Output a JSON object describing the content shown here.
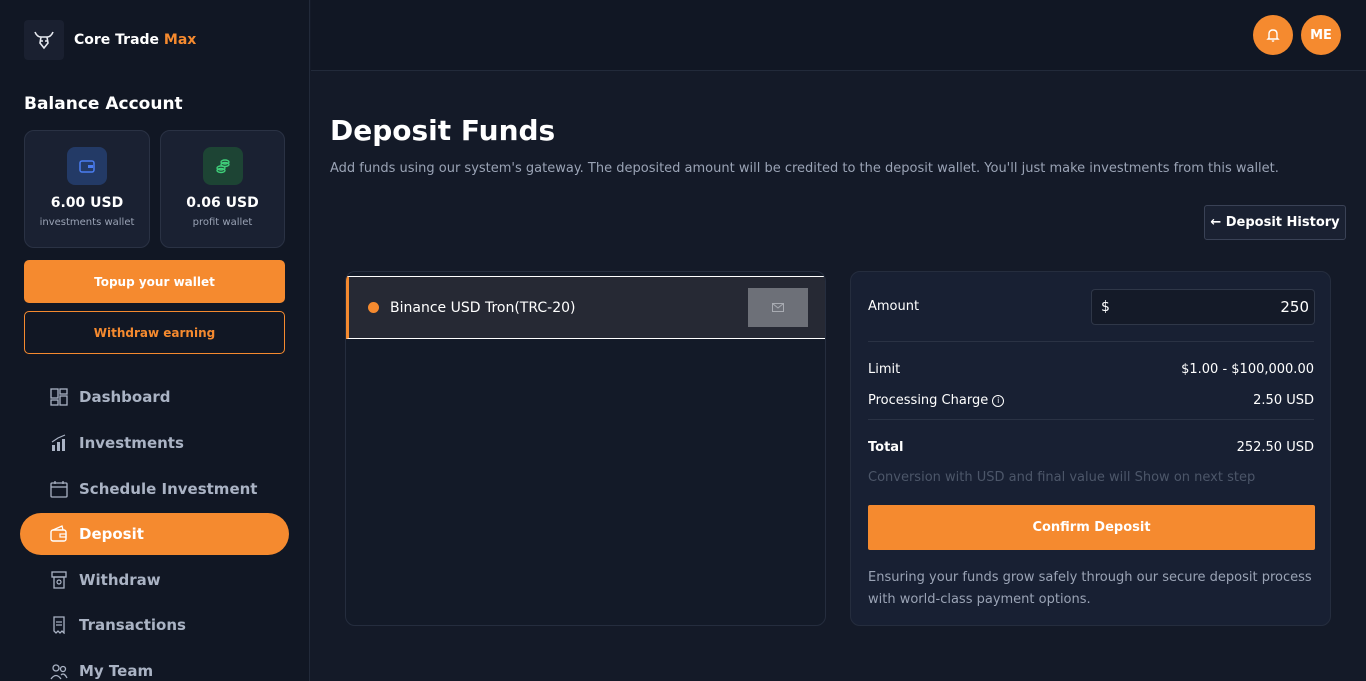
{
  "brand": {
    "name": "Core Trade",
    "accent": "Max"
  },
  "balance": {
    "title": "Balance Account",
    "wallets": [
      {
        "amount": "6.00 USD",
        "label": "investments wallet",
        "icon": "wallet-icon"
      },
      {
        "amount": "0.06 USD",
        "label": "profit wallet",
        "icon": "coins-icon"
      }
    ],
    "topup_label": "Topup your wallet",
    "withdraw_label": "Withdraw earning"
  },
  "nav": {
    "items": [
      {
        "label": "Dashboard",
        "icon": "dashboard-icon"
      },
      {
        "label": "Investments",
        "icon": "chart-icon"
      },
      {
        "label": "Schedule Investment",
        "icon": "calendar-icon"
      },
      {
        "label": "Deposit",
        "icon": "wallet-icon",
        "active": true
      },
      {
        "label": "Withdraw",
        "icon": "atm-icon"
      },
      {
        "label": "Transactions",
        "icon": "receipt-icon"
      },
      {
        "label": "My Team",
        "icon": "team-icon"
      }
    ]
  },
  "topbar": {
    "avatar_initials": "ME",
    "bell_icon": "bell-icon"
  },
  "main": {
    "title": "Deposit Funds",
    "subtitle": "Add funds using our system's gateway. The deposited amount will be credited to the deposit wallet. You'll just make investments from this wallet.",
    "history_label": "← Deposit History"
  },
  "gateway": {
    "name": "Binance USD Tron(TRC-20)",
    "selected": true
  },
  "summary": {
    "amount_label": "Amount",
    "currency_symbol": "$",
    "amount_value": "250",
    "limit_label": "Limit",
    "limit_value": "$1.00 - $100,000.00",
    "charge_label": "Processing Charge",
    "charge_value": "2.50 USD",
    "total_label": "Total",
    "total_value": "252.50 USD",
    "conversion_note": "Conversion with USD and final value will Show on next step",
    "confirm_label": "Confirm Deposit",
    "secure_note": "Ensuring your funds grow safely through our secure deposit process with world-class payment options."
  },
  "colors": {
    "accent": "#f58a2f",
    "background": "#141a28",
    "sidebar": "#111724"
  }
}
